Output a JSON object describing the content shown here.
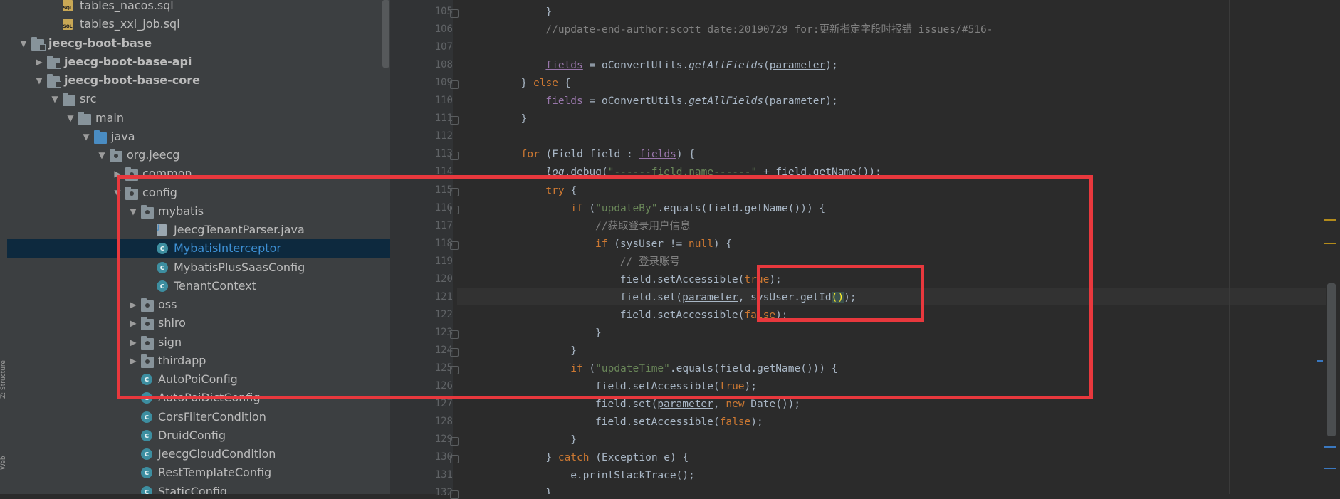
{
  "project_tree": {
    "items": [
      {
        "label": "tables_nacos.sql",
        "depth": 3,
        "icon": "sql-file-icon",
        "arrow": "",
        "bold": false,
        "selected": false
      },
      {
        "label": "tables_xxl_job.sql",
        "depth": 3,
        "icon": "sql-file-icon",
        "arrow": "",
        "bold": false,
        "selected": false
      },
      {
        "label": "jeecg-boot-base",
        "depth": 1,
        "icon": "module-folder-icon",
        "arrow": "expanded",
        "bold": true,
        "selected": false
      },
      {
        "label": "jeecg-boot-base-api",
        "depth": 2,
        "icon": "module-folder-icon",
        "arrow": "collapsed",
        "bold": true,
        "selected": false
      },
      {
        "label": "jeecg-boot-base-core",
        "depth": 2,
        "icon": "module-folder-icon",
        "arrow": "expanded",
        "bold": true,
        "selected": false
      },
      {
        "label": "src",
        "depth": 3,
        "icon": "folder-icon",
        "arrow": "expanded",
        "bold": false,
        "selected": false
      },
      {
        "label": "main",
        "depth": 4,
        "icon": "folder-icon",
        "arrow": "expanded",
        "bold": false,
        "selected": false
      },
      {
        "label": "java",
        "depth": 5,
        "icon": "source-folder-icon",
        "arrow": "expanded",
        "bold": false,
        "selected": false
      },
      {
        "label": "org.jeecg",
        "depth": 6,
        "icon": "package-icon",
        "arrow": "expanded",
        "bold": false,
        "selected": false
      },
      {
        "label": "common",
        "depth": 7,
        "icon": "package-icon",
        "arrow": "collapsed",
        "bold": false,
        "selected": false
      },
      {
        "label": "config",
        "depth": 7,
        "icon": "package-icon",
        "arrow": "expanded",
        "bold": false,
        "selected": false
      },
      {
        "label": "mybatis",
        "depth": 8,
        "icon": "package-icon",
        "arrow": "expanded",
        "bold": false,
        "selected": false
      },
      {
        "label": "JeecgTenantParser.java",
        "depth": 9,
        "icon": "java-file-icon",
        "arrow": "",
        "bold": false,
        "selected": false
      },
      {
        "label": "MybatisInterceptor",
        "depth": 9,
        "icon": "class-icon",
        "arrow": "",
        "bold": false,
        "selected": true
      },
      {
        "label": "MybatisPlusSaasConfig",
        "depth": 9,
        "icon": "class-icon",
        "arrow": "",
        "bold": false,
        "selected": false
      },
      {
        "label": "TenantContext",
        "depth": 9,
        "icon": "class-icon",
        "arrow": "",
        "bold": false,
        "selected": false
      },
      {
        "label": "oss",
        "depth": 8,
        "icon": "package-icon",
        "arrow": "collapsed",
        "bold": false,
        "selected": false
      },
      {
        "label": "shiro",
        "depth": 8,
        "icon": "package-icon",
        "arrow": "collapsed",
        "bold": false,
        "selected": false
      },
      {
        "label": "sign",
        "depth": 8,
        "icon": "package-icon",
        "arrow": "collapsed",
        "bold": false,
        "selected": false
      },
      {
        "label": "thirdapp",
        "depth": 8,
        "icon": "package-icon",
        "arrow": "collapsed",
        "bold": false,
        "selected": false
      },
      {
        "label": "AutoPoiConfig",
        "depth": 8,
        "icon": "class-icon",
        "arrow": "",
        "bold": false,
        "selected": false
      },
      {
        "label": "AutoPoiDictConfig",
        "depth": 8,
        "icon": "class-icon",
        "arrow": "",
        "bold": false,
        "selected": false
      },
      {
        "label": "CorsFilterCondition",
        "depth": 8,
        "icon": "class-icon",
        "arrow": "",
        "bold": false,
        "selected": false
      },
      {
        "label": "DruidConfig",
        "depth": 8,
        "icon": "class-icon",
        "arrow": "",
        "bold": false,
        "selected": false
      },
      {
        "label": "JeecgCloudCondition",
        "depth": 8,
        "icon": "class-icon",
        "arrow": "",
        "bold": false,
        "selected": false
      },
      {
        "label": "RestTemplateConfig",
        "depth": 8,
        "icon": "class-icon",
        "arrow": "",
        "bold": false,
        "selected": false
      },
      {
        "label": "StaticConfig",
        "depth": 8,
        "icon": "class-icon",
        "arrow": "",
        "bold": false,
        "selected": false
      }
    ],
    "class_icon_glyph": "c"
  },
  "side_tabs": {
    "structure": "Z: Structure",
    "web": "Web"
  },
  "editor": {
    "caret_line": 121,
    "lines": [
      {
        "n": 105,
        "indent": 12,
        "tokens": [
          [
            "p",
            "}"
          ]
        ]
      },
      {
        "n": 106,
        "indent": 12,
        "tokens": [
          [
            "cmt",
            "//update-end-author:scott date:20190729 for:更新指定字段时报错 issues/#516-"
          ]
        ]
      },
      {
        "n": 107,
        "indent": 0,
        "tokens": []
      },
      {
        "n": 108,
        "indent": 12,
        "tokens": [
          [
            "fld",
            "fields"
          ],
          [
            "p",
            " = oConvertUtils."
          ],
          [
            "ital",
            "getAllFields"
          ],
          [
            "p",
            "("
          ],
          [
            "param",
            "parameter"
          ],
          [
            "p",
            ");"
          ]
        ]
      },
      {
        "n": 109,
        "indent": 8,
        "tokens": [
          [
            "p",
            "} "
          ],
          [
            "kw",
            "else"
          ],
          [
            "p",
            " {"
          ]
        ]
      },
      {
        "n": 110,
        "indent": 12,
        "tokens": [
          [
            "fld",
            "fields"
          ],
          [
            "p",
            " = oConvertUtils."
          ],
          [
            "ital",
            "getAllFields"
          ],
          [
            "p",
            "("
          ],
          [
            "param",
            "parameter"
          ],
          [
            "p",
            ");"
          ]
        ]
      },
      {
        "n": 111,
        "indent": 8,
        "tokens": [
          [
            "p",
            "}"
          ]
        ]
      },
      {
        "n": 112,
        "indent": 0,
        "tokens": []
      },
      {
        "n": 113,
        "indent": 8,
        "tokens": [
          [
            "kw",
            "for"
          ],
          [
            "p",
            " (Field field : "
          ],
          [
            "fld",
            "fields"
          ],
          [
            "p",
            ") {"
          ]
        ]
      },
      {
        "n": 114,
        "indent": 12,
        "tokens": [
          [
            "ital",
            "log"
          ],
          [
            "p",
            ".debug("
          ],
          [
            "str",
            "\"------field.name------\""
          ],
          [
            "p",
            " + field.getName());"
          ]
        ]
      },
      {
        "n": 115,
        "indent": 12,
        "tokens": [
          [
            "kw",
            "try"
          ],
          [
            "p",
            " {"
          ]
        ]
      },
      {
        "n": 116,
        "indent": 16,
        "tokens": [
          [
            "kw",
            "if"
          ],
          [
            "p",
            " ("
          ],
          [
            "str",
            "\"updateBy\""
          ],
          [
            "p",
            ".equals(field.getName())) {"
          ]
        ]
      },
      {
        "n": 117,
        "indent": 20,
        "tokens": [
          [
            "cmt",
            "//获取登录用户信息"
          ]
        ]
      },
      {
        "n": 118,
        "indent": 20,
        "tokens": [
          [
            "kw",
            "if"
          ],
          [
            "p",
            " (sysUser != "
          ],
          [
            "kw",
            "null"
          ],
          [
            "p",
            ") {"
          ]
        ]
      },
      {
        "n": 119,
        "indent": 24,
        "tokens": [
          [
            "cmt",
            "// 登录账号"
          ]
        ]
      },
      {
        "n": 120,
        "indent": 24,
        "tokens": [
          [
            "p",
            "field.setAccessible("
          ],
          [
            "kw",
            "true"
          ],
          [
            "p",
            ");"
          ]
        ]
      },
      {
        "n": 121,
        "indent": 24,
        "tokens": [
          [
            "p",
            "field.set("
          ],
          [
            "param",
            "parameter"
          ],
          [
            "p",
            ", sysUser.getId"
          ],
          [
            "hl",
            "()"
          ],
          [
            "p",
            ");"
          ]
        ]
      },
      {
        "n": 122,
        "indent": 24,
        "tokens": [
          [
            "p",
            "field.setAccessible("
          ],
          [
            "kw",
            "false"
          ],
          [
            "p",
            ");"
          ]
        ]
      },
      {
        "n": 123,
        "indent": 20,
        "tokens": [
          [
            "p",
            "}"
          ]
        ]
      },
      {
        "n": 124,
        "indent": 16,
        "tokens": [
          [
            "p",
            "}"
          ]
        ]
      },
      {
        "n": 125,
        "indent": 16,
        "tokens": [
          [
            "kw",
            "if"
          ],
          [
            "p",
            " ("
          ],
          [
            "str",
            "\"updateTime\""
          ],
          [
            "p",
            ".equals(field.getName())) {"
          ]
        ]
      },
      {
        "n": 126,
        "indent": 20,
        "tokens": [
          [
            "p",
            "field.setAccessible("
          ],
          [
            "kw",
            "true"
          ],
          [
            "p",
            ");"
          ]
        ]
      },
      {
        "n": 127,
        "indent": 20,
        "tokens": [
          [
            "p",
            "field.set("
          ],
          [
            "param",
            "parameter"
          ],
          [
            "p",
            ", "
          ],
          [
            "kw",
            "new"
          ],
          [
            "p",
            " Date());"
          ]
        ]
      },
      {
        "n": 128,
        "indent": 20,
        "tokens": [
          [
            "p",
            "field.setAccessible("
          ],
          [
            "kw",
            "false"
          ],
          [
            "p",
            ");"
          ]
        ]
      },
      {
        "n": 129,
        "indent": 16,
        "tokens": [
          [
            "p",
            "}"
          ]
        ]
      },
      {
        "n": 130,
        "indent": 12,
        "tokens": [
          [
            "p",
            "} "
          ],
          [
            "kw",
            "catch"
          ],
          [
            "p",
            " (Exception e) {"
          ]
        ]
      },
      {
        "n": 131,
        "indent": 16,
        "tokens": [
          [
            "p",
            "e.printStackTrace();"
          ]
        ]
      },
      {
        "n": 132,
        "indent": 12,
        "tokens": [
          [
            "p",
            "}"
          ]
        ]
      }
    ]
  },
  "colors": {
    "annotation_red": "#e8383d",
    "selection_bg": "#0d293e",
    "keyword": "#cc7832",
    "string": "#6a8759",
    "comment": "#808080",
    "field": "#9876aa"
  }
}
